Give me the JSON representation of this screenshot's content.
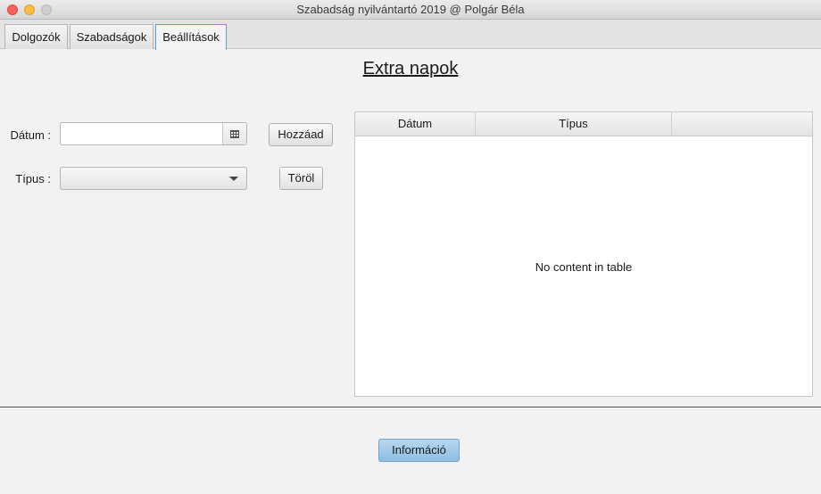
{
  "window": {
    "title": "Szabadság nyilvántartó 2019 @ Polgár Béla"
  },
  "tabs": [
    {
      "label": "Dolgozók",
      "active": false
    },
    {
      "label": "Szabadságok",
      "active": false
    },
    {
      "label": "Beállítások",
      "active": true
    }
  ],
  "section": {
    "title": "Extra napok"
  },
  "form": {
    "date_label": "Dátum :",
    "date_value": "",
    "type_label": "Típus :",
    "type_value": "",
    "add_button": "Hozzáad",
    "delete_button": "Töröl"
  },
  "table": {
    "columns": [
      "Dátum",
      "Típus",
      ""
    ],
    "rows": [],
    "placeholder": "No content in table"
  },
  "footer": {
    "info_button": "Információ"
  },
  "colors": {
    "accent": "#5ba4d8",
    "primary_button": "#9fcbe9"
  }
}
